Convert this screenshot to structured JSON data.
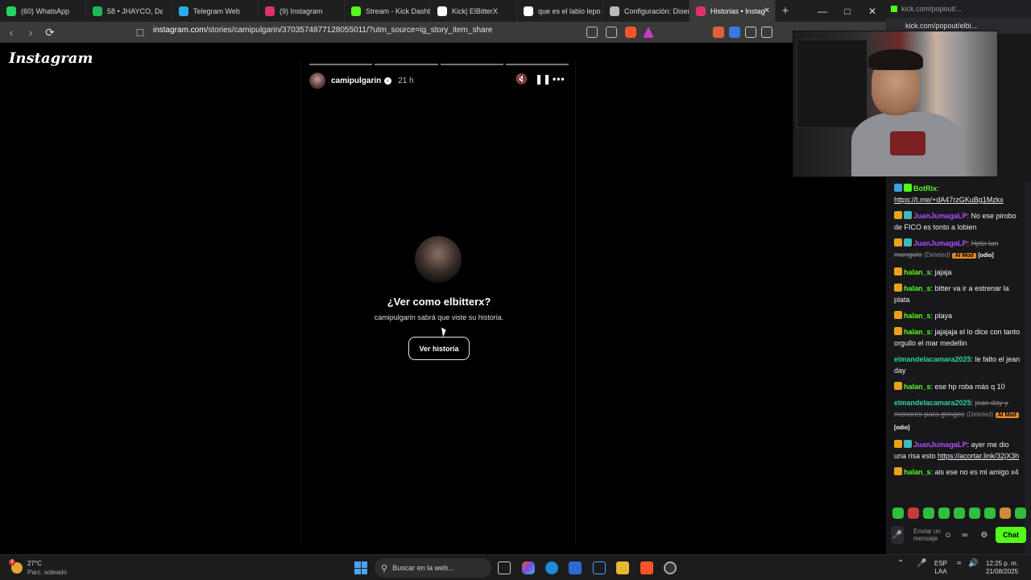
{
  "browser": {
    "tabs": [
      {
        "label": "(60) WhatsApp",
        "icon": "whatsapp-icon",
        "color": "#25d366"
      },
      {
        "label": "58 • JHAYCO, Dε",
        "icon": "spotify-icon",
        "color": "#1db954"
      },
      {
        "label": "Telegram Web",
        "icon": "telegram-icon",
        "color": "#2aabee"
      },
      {
        "label": "(9) Instagram",
        "icon": "instagram-icon",
        "color": "#e1306c"
      },
      {
        "label": "Stream - Kick Dashb",
        "icon": "kick-icon",
        "color": "#53fc18"
      },
      {
        "label": "Kick| ElBitterX",
        "icon": "tiktok-icon",
        "color": "#ffffff"
      },
      {
        "label": "que es el labio lepo",
        "icon": "google-icon",
        "color": "#ffffff"
      },
      {
        "label": "Configuración: Diseñ",
        "icon": "gear-icon",
        "color": "#bbbbbb"
      },
      {
        "label": "Historias • Instag",
        "icon": "instagram-icon",
        "color": "#e1306c"
      }
    ],
    "new_tab": "+",
    "url_host": "instagram.com",
    "url_path": "/stories/camipulgarin/3703574877128055011/?utm_source=ig_story_item_share"
  },
  "instagram": {
    "logo": "Instagram",
    "story": {
      "username": "camipulgarin",
      "time": "21 h",
      "question": "¿Ver como elbitterx?",
      "subtitle": "camipulgarin sabrá que viste su historia.",
      "button": "Ver historia"
    }
  },
  "popout": {
    "title": "kick.com/popout/...",
    "url": "kick.com/popout/elbi...",
    "messages": [
      {
        "badges": [
          "bot",
          "vchk"
        ],
        "user": "BotRix",
        "ucolor": "u-green",
        "text": "",
        "link": "https://t.me/+dA47rzGKuBg1Mzkx"
      },
      {
        "badges": [
          "crown",
          "sub"
        ],
        "user": "JuanJumagaLP",
        "ucolor": "u-purple",
        "text": "No ese pirobo de FICO es tonto a lobien"
      },
      {
        "badges": [
          "crown",
          "sub"
        ],
        "user": "JuanJumagaLP",
        "ucolor": "u-purple",
        "deleted": "Hpta tan mongolo",
        "deltag": "(Deleted)",
        "aimod": "AI Mod",
        "reason": "[odio]"
      },
      {
        "badges": [
          "crown"
        ],
        "user": "halan_s",
        "ucolor": "u-green",
        "text": "jajaja"
      },
      {
        "badges": [
          "crown"
        ],
        "user": "halan_s",
        "ucolor": "u-green",
        "text": "bitter va ir a estrenar la plata"
      },
      {
        "badges": [
          "crown"
        ],
        "user": "halan_s",
        "ucolor": "u-green",
        "text": "playa"
      },
      {
        "badges": [
          "crown"
        ],
        "user": "halan_s",
        "ucolor": "u-green",
        "text": "jajajaja el lo dice con tanto orgullo el mar medellin"
      },
      {
        "badges": [],
        "user": "elmandelacamara2025",
        "ucolor": "u-teal",
        "text": "le falto el jean day"
      },
      {
        "badges": [
          "crown"
        ],
        "user": "halan_s",
        "ucolor": "u-green",
        "text": "ese hp roba más q 10"
      },
      {
        "badges": [],
        "user": "elmandelacamara2025",
        "ucolor": "u-teal",
        "deleted": "jean day y menores para gringos",
        "deltag": "(Deleted)",
        "aimod": "AI Mod",
        "reason": "[odio]"
      },
      {
        "badges": [
          "crown",
          "sub"
        ],
        "user": "JuanJumagaLP",
        "ucolor": "u-purple",
        "text": "ayer me dio una risa esto",
        "link": "https://acortar.link/32jX3h"
      },
      {
        "badges": [
          "crown"
        ],
        "user": "halan_s",
        "ucolor": "u-green",
        "text": "ais ese no es mi amigo x4"
      }
    ],
    "send_placeholder": "Enviar un mensaje",
    "chat_button": "Chat"
  },
  "taskbar": {
    "temp": "27°C",
    "weather": "Parc. soleado",
    "weather_badge": "4",
    "search_placeholder": "Buscar en la web...",
    "lang": "ESP",
    "lang2": "LAA",
    "time": "12:25 p. m.",
    "date": "21/08/2025"
  }
}
